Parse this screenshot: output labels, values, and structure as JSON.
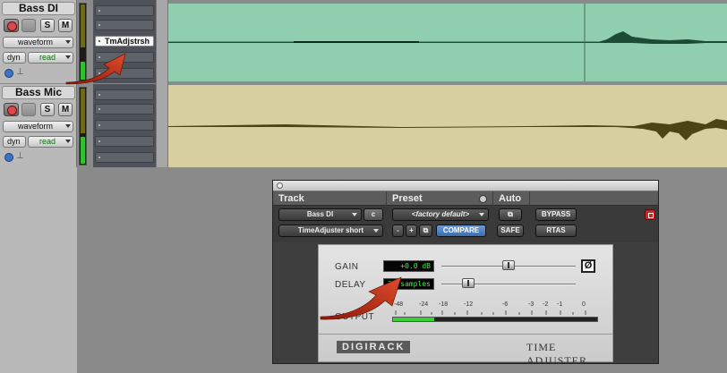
{
  "tracks": [
    {
      "name": "Bass DI",
      "solo_label": "S",
      "mute_label": "M",
      "view": "waveform",
      "dyn_label": "dyn",
      "automation": "read",
      "insert_plugin": "TmAdjstrsh"
    },
    {
      "name": "Bass Mic",
      "solo_label": "S",
      "mute_label": "M",
      "view": "waveform",
      "dyn_label": "dyn",
      "automation": "read"
    }
  ],
  "plugin": {
    "headers": {
      "track": "Track",
      "preset": "Preset",
      "auto": "Auto"
    },
    "track_select": "Bass DI",
    "channel": "c",
    "preset_select": "<factory default>",
    "plugin_select": "TimeAdjuster short",
    "minus": "-",
    "plus": "+",
    "compare": "COMPARE",
    "safe": "SAFE",
    "bypass": "BYPASS",
    "rtas": "RTAS",
    "gain_label": "GAIN",
    "gain_value": "+0.0 dB",
    "phase_symbol": "Ø",
    "delay_label": "DELAY",
    "delay_value": "37 samples",
    "output_label": "OUTPUT",
    "meter_ticks": [
      "-48",
      "-24",
      "-18",
      "-12",
      "-6",
      "-3",
      "-2",
      "-1",
      "0"
    ],
    "brand": "DIGIRACK",
    "product": "TIME ADJUSTER",
    "output_level": 0.2
  },
  "colors": {
    "lane1": "#8fcfb0",
    "lane2": "#d8cfa0",
    "wave1": "#1d4a34",
    "wave2": "#4a4416",
    "arrow": "#c8331c",
    "lcd_text": "#3bf03b"
  }
}
